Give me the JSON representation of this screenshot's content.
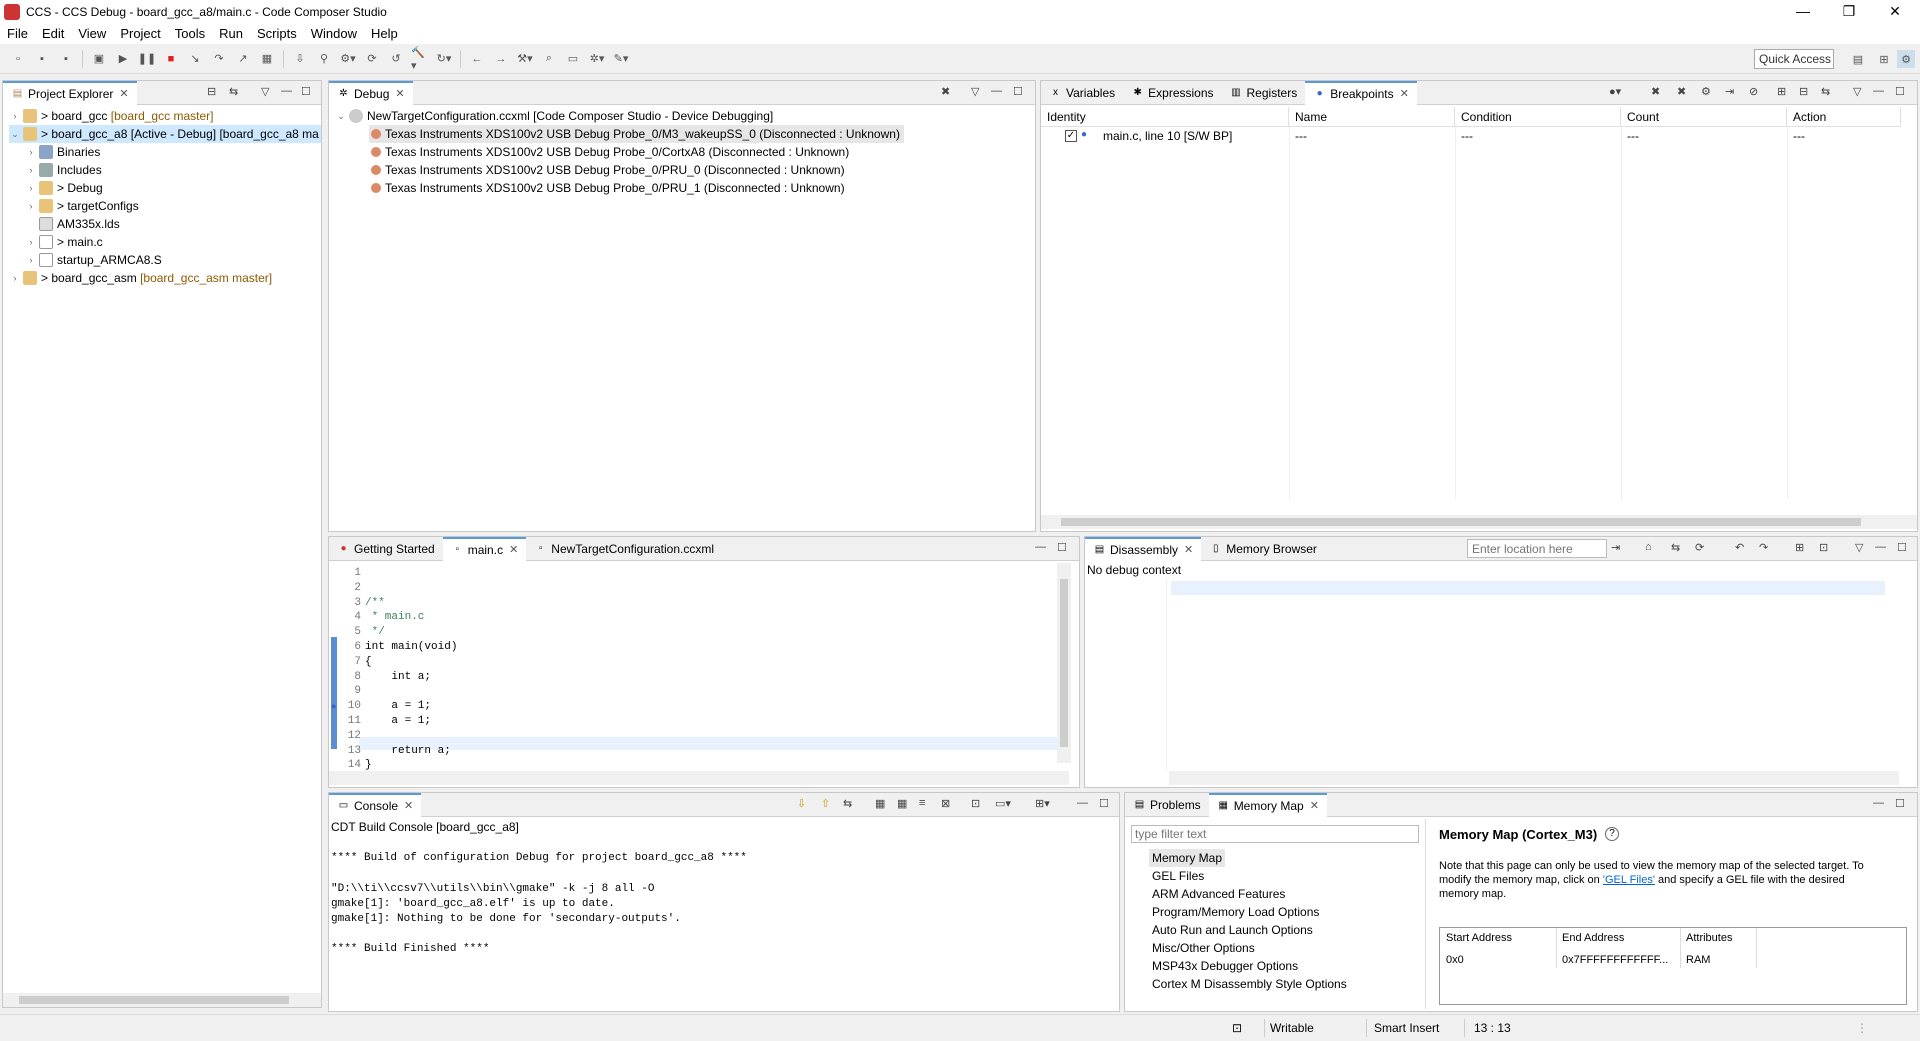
{
  "window": {
    "title": "CCS - CCS Debug - board_gcc_a8/main.c - Code Composer Studio",
    "minimize": "—",
    "maximize": "❐",
    "close": "✕"
  },
  "menu": [
    "File",
    "Edit",
    "View",
    "Project",
    "Tools",
    "Run",
    "Scripts",
    "Window",
    "Help"
  ],
  "toolbar": {
    "quick_access": "Quick Access"
  },
  "project_explorer": {
    "tab": "Project Explorer",
    "items": [
      {
        "label": "> board_gcc",
        "suffix": "[board_gcc master]"
      },
      {
        "label": "> board_gcc_a8  [Active - Debug] [board_gcc_a8 ma",
        "suffix": ""
      },
      {
        "label": "Binaries"
      },
      {
        "label": "Includes"
      },
      {
        "label": "> Debug"
      },
      {
        "label": "> targetConfigs"
      },
      {
        "label": "AM335x.lds"
      },
      {
        "label": "> main.c"
      },
      {
        "label": "startup_ARMCA8.S"
      },
      {
        "label": "> board_gcc_asm",
        "suffix": "[board_gcc_asm master]"
      }
    ]
  },
  "debug": {
    "tab": "Debug",
    "root": "NewTargetConfiguration.ccxml [Code Composer Studio - Device Debugging]",
    "items": [
      "Texas Instruments XDS100v2 USB Debug Probe_0/M3_wakeupSS_0 (Disconnected : Unknown)",
      "Texas Instruments XDS100v2 USB Debug Probe_0/CortxA8 (Disconnected : Unknown)",
      "Texas Instruments XDS100v2 USB Debug Probe_0/PRU_0 (Disconnected : Unknown)",
      "Texas Instruments XDS100v2 USB Debug Probe_0/PRU_1 (Disconnected : Unknown)"
    ]
  },
  "breakpoints": {
    "tabs": [
      "Variables",
      "Expressions",
      "Registers",
      "Breakpoints"
    ],
    "columns": [
      "Identity",
      "Name",
      "Condition",
      "Count",
      "Action"
    ],
    "rows": [
      {
        "identity": "main.c, line 10 [S/W BP]",
        "name": "---",
        "condition": "---",
        "count": "---",
        "action": "---"
      }
    ]
  },
  "editor": {
    "tabs": [
      "Getting Started",
      "main.c",
      "NewTargetConfiguration.ccxml"
    ],
    "lines": [
      {
        "n": "1",
        "t": ""
      },
      {
        "n": "2",
        "t": ""
      },
      {
        "n": "3",
        "t": "/**"
      },
      {
        "n": "4",
        "t": " * main.c"
      },
      {
        "n": "5",
        "t": " */"
      },
      {
        "n": "6",
        "t": "int main(void)"
      },
      {
        "n": "7",
        "t": "{"
      },
      {
        "n": "8",
        "t": "    int a;"
      },
      {
        "n": "9",
        "t": ""
      },
      {
        "n": "10",
        "t": "    a = 1;"
      },
      {
        "n": "11",
        "t": "    a = 1;"
      },
      {
        "n": "12",
        "t": ""
      },
      {
        "n": "13",
        "t": "    return a;"
      },
      {
        "n": "14",
        "t": "}"
      }
    ]
  },
  "disassembly": {
    "tabs": [
      "Disassembly",
      "Memory Browser"
    ],
    "location_placeholder": "Enter location here",
    "status": "No debug context"
  },
  "console": {
    "tab": "Console",
    "title": "CDT Build Console [board_gcc_a8]",
    "lines": [
      "",
      "**** Build of configuration Debug for project board_gcc_a8 ****",
      "",
      "\"D:\\\\ti\\\\ccsv7\\\\utils\\\\bin\\\\gmake\" -k -j 8 all -O",
      "gmake[1]: 'board_gcc_a8.elf' is up to date.",
      "gmake[1]: Nothing to be done for 'secondary-outputs'.",
      "",
      "**** Build Finished ****"
    ]
  },
  "memory_map": {
    "tabs": [
      "Problems",
      "Memory Map"
    ],
    "filter_placeholder": "type filter text",
    "items": [
      "Memory Map",
      "GEL Files",
      "ARM Advanced Features",
      "Program/Memory Load Options",
      "Auto Run and Launch Options",
      "Misc/Other Options",
      "MSP43x Debugger Options",
      "Cortex M Disassembly Style Options"
    ],
    "heading": "Memory Map (Cortex_M3)",
    "help": "?",
    "note_pre": "Note that this page can only be used to view the memory map of the selected target.  To modify the memory map, click on ",
    "note_link": "'GEL Files'",
    "note_post": " and specify a GEL file with the desired memory map.",
    "columns": [
      "Start Address",
      "End Address",
      "Attributes"
    ],
    "rows": [
      {
        "start": "0x0",
        "end": "0x7FFFFFFFFFFFF...",
        "attr": "RAM"
      }
    ]
  },
  "status": {
    "writable": "Writable",
    "insert": "Smart Insert",
    "pos": "13 : 13"
  }
}
